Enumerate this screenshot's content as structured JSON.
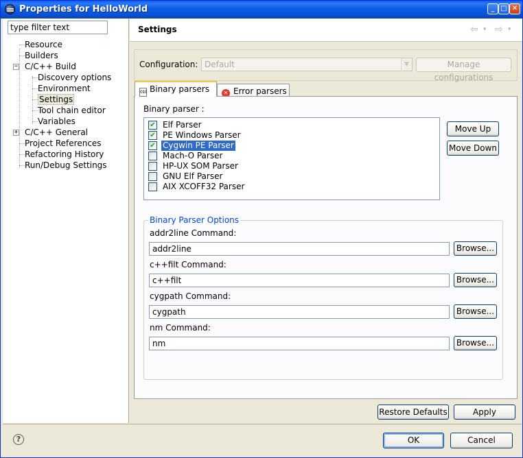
{
  "window": {
    "title": "Properties for HelloWorld",
    "minimize": "_",
    "maximize": "□",
    "close": "✕"
  },
  "filter": {
    "value": "type filter text"
  },
  "tree": {
    "expand": "+",
    "collapse": "−",
    "items": [
      {
        "label": "Resource"
      },
      {
        "label": "Builders"
      },
      {
        "label": "C/C++ Build"
      },
      {
        "label": "Discovery options"
      },
      {
        "label": "Environment"
      },
      {
        "label": "Settings"
      },
      {
        "label": "Tool chain editor"
      },
      {
        "label": "Variables"
      },
      {
        "label": "C/C++ General"
      },
      {
        "label": "Project References"
      },
      {
        "label": "Refactoring History"
      },
      {
        "label": "Run/Debug Settings"
      }
    ]
  },
  "header": {
    "title": "Settings",
    "back": "⇦",
    "forward": "⇨",
    "dropdown": "▾"
  },
  "configuration": {
    "label": "Configuration:",
    "value": "Default",
    "arrow": "▼",
    "manage": "Manage configurations"
  },
  "tabs": [
    {
      "label": "Binary parsers",
      "icon": "binary-icon"
    },
    {
      "label": "Error parsers",
      "icon": "error-icon"
    }
  ],
  "tab_icons": {
    "binary": "010",
    "error": "✕"
  },
  "parsers": {
    "label": "Binary parser :",
    "check": "✔",
    "items": [
      {
        "name": "Elf Parser",
        "checked": true
      },
      {
        "name": "PE Windows Parser",
        "checked": true
      },
      {
        "name": "Cygwin PE Parser",
        "checked": true,
        "selected": true
      },
      {
        "name": "Mach-O Parser",
        "checked": false
      },
      {
        "name": "HP-UX SOM Parser",
        "checked": false
      },
      {
        "name": "GNU Elf Parser",
        "checked": false
      },
      {
        "name": "AIX XCOFF32 Parser",
        "checked": false
      }
    ],
    "move_up": "Move Up",
    "move_down": "Move Down"
  },
  "options": {
    "legend": "Binary Parser Options",
    "browse": "Browse...",
    "fields": [
      {
        "label": "addr2line Command:",
        "value": "addr2line"
      },
      {
        "label": "c++filt Command:",
        "value": "c++filt"
      },
      {
        "label": "cygpath Command:",
        "value": "cygpath"
      },
      {
        "label": "nm Command:",
        "value": "nm"
      }
    ]
  },
  "buttons": {
    "restore": "Restore Defaults",
    "apply": "Apply",
    "ok": "OK",
    "cancel": "Cancel",
    "help": "?"
  }
}
